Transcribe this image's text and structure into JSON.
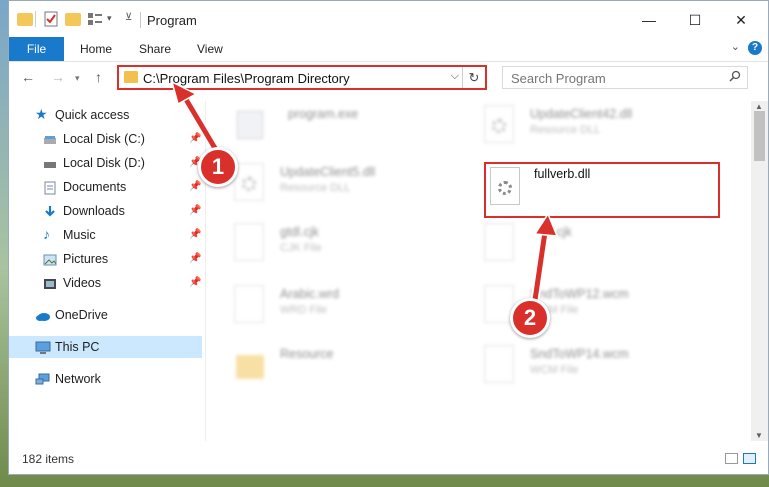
{
  "window": {
    "title": "Program",
    "controls": {
      "minimize": "—",
      "maximize": "☐",
      "close": "✕"
    }
  },
  "ribbon": {
    "file_tab": "File",
    "tabs": [
      "Home",
      "Share",
      "View"
    ],
    "expand_glyph": "⌄",
    "help_glyph": "?"
  },
  "navigation": {
    "back": "←",
    "forward": "→",
    "up": "↑"
  },
  "address_bar": {
    "path": "C:\\Program Files\\Program Directory",
    "dropdown_glyph": "⌵",
    "refresh_glyph": "↻"
  },
  "search": {
    "placeholder": "Search Program",
    "icon": "search-icon"
  },
  "nav_pane": {
    "items": [
      {
        "label": "Quick access",
        "icon": "star-icon",
        "pinned": false
      },
      {
        "label": "Local Disk (C:)",
        "icon": "drive-icon",
        "pinned": true
      },
      {
        "label": "Local Disk (D:)",
        "icon": "drive-icon",
        "pinned": true
      },
      {
        "label": "Documents",
        "icon": "documents-icon",
        "pinned": true
      },
      {
        "label": "Downloads",
        "icon": "download-icon",
        "pinned": true
      },
      {
        "label": "Music",
        "icon": "music-icon",
        "pinned": true
      },
      {
        "label": "Pictures",
        "icon": "pictures-icon",
        "pinned": true
      },
      {
        "label": "Videos",
        "icon": "video-icon",
        "pinned": true
      },
      {
        "label": "OneDrive",
        "icon": "cloud-icon",
        "pinned": false
      },
      {
        "label": "This PC",
        "icon": "computer-icon",
        "pinned": false
      },
      {
        "label": "Network",
        "icon": "network-icon",
        "pinned": false
      }
    ],
    "pin_glyph": "📌"
  },
  "files": [
    {
      "name": "program.exe",
      "type": "",
      "icon": "exe-icon"
    },
    {
      "name": "UpdateClient42.dll",
      "type": "Resource DLL",
      "icon": "dll-icon"
    },
    {
      "name": "UpdateClient5.dll",
      "type": "Resource DLL",
      "icon": "dll-icon"
    },
    {
      "name": "fullverb.dll",
      "type": "",
      "icon": "dll-icon"
    },
    {
      "name": "gtdl.cjk",
      "type": "CJK File",
      "icon": "file-icon"
    },
    {
      "name": "...cjk",
      "type": "",
      "icon": "file-icon"
    },
    {
      "name": "Arabic.wrd",
      "type": "WRD File",
      "icon": "file-icon"
    },
    {
      "name": "SndToWP12.wcm",
      "type": "WCM File",
      "icon": "file-icon"
    },
    {
      "name": "Resource",
      "type": "",
      "icon": "folder-icon"
    },
    {
      "name": "SndToWP14.wcm",
      "type": "WCM File",
      "icon": "file-icon"
    }
  ],
  "status_bar": {
    "item_count": "182 items"
  },
  "annotations": {
    "step1": "1",
    "step2": "2"
  },
  "colors": {
    "accent": "#1979ca",
    "highlight": "#d9302c",
    "selected": "#cce8ff"
  }
}
